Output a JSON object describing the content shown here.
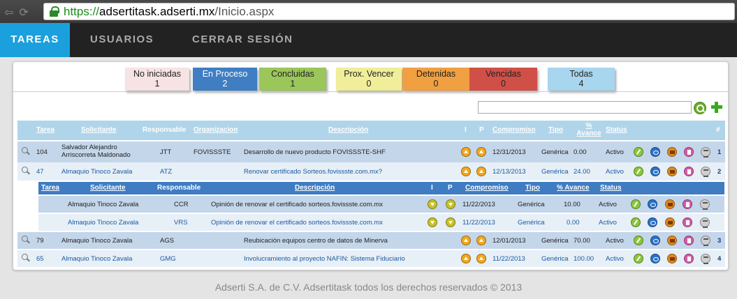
{
  "browser": {
    "url_scheme": "https://",
    "url_host": "adsertitask.adserti.mx",
    "url_path": "/Inicio.aspx"
  },
  "nav": {
    "tareas": "TAREAS",
    "usuarios": "USUARIOS",
    "cerrar": "CERRAR SESIÓN"
  },
  "filters": [
    {
      "label": "No iniciadas",
      "count": "1",
      "color": "#f7e3e3"
    },
    {
      "label": "En Proceso",
      "count": "2",
      "color": "#3f7ec2"
    },
    {
      "label": "Concluidas",
      "count": "1",
      "color": "#9bc65a"
    },
    {
      "label": "Prox. Vencer",
      "count": "0",
      "color": "#f0ee98"
    },
    {
      "label": "Detenidas",
      "count": "0",
      "color": "#f0a040"
    },
    {
      "label": "Vencidas",
      "count": "0",
      "color": "#d05048"
    },
    {
      "label": "Todas",
      "count": "4",
      "color": "#a8d6ee"
    }
  ],
  "table": {
    "headers": {
      "tarea": "Tarea",
      "solicitante": "Solicitante",
      "responsable": "Responsable",
      "organizacion": "Organizacion",
      "descripcion": "Descripción",
      "i": "I",
      "p": "P",
      "compromiso": "Compromiso",
      "tipo": "Tipo",
      "avance_1": "%",
      "avance_2": "Avance",
      "status": "Status",
      "num": "#"
    },
    "rows": [
      {
        "tarea": "104",
        "solicitante_1": "Salvador Alejandro",
        "solicitante_2": "Arriscorreta Maldonado",
        "responsable": "JTT",
        "organizacion": "FOVISSSTE",
        "descripcion": "Desarrollo de nuevo producto FOVISSSTE-SHF",
        "compromiso": "12/31/2013",
        "tipo": "Genérica",
        "avance": "0.00",
        "status": "Activo",
        "num": "1"
      },
      {
        "tarea": "47",
        "solicitante": "Almaquio Tinoco Zavala",
        "responsable": "ATZ",
        "descripcion": "Renovar certificado Sorteos.fovissste.com.mx?",
        "compromiso": "12/13/2013",
        "tipo": "Genérica",
        "avance": "24.00",
        "status": "Activo",
        "num": "2"
      },
      {
        "tarea": "79",
        "solicitante": "Almaquio Tinoco Zavala",
        "responsable": "AGS",
        "descripcion": "Reubicación equipos centro de datos de Minerva",
        "compromiso": "12/01/2013",
        "tipo": "Genérica",
        "avance": "70.00",
        "status": "Activo",
        "num": "3"
      },
      {
        "tarea": "65",
        "solicitante": "Almaquio Tinoco Zavala",
        "responsable": "GMG",
        "descripcion": "Involucramiento al proyecto NAFIN: Sistema Fiduciario",
        "compromiso": "11/22/2013",
        "tipo": "Genérica",
        "avance": "100.00",
        "status": "Activo",
        "num": "4"
      }
    ]
  },
  "subtable": {
    "headers": {
      "tarea": "Tarea",
      "solicitante": "Solicitante",
      "responsable": "Responsable",
      "descripcion": "Descripción",
      "i": "I",
      "p": "P",
      "compromiso": "Compromiso",
      "tipo": "Tipo",
      "avance": "% Avance",
      "status": "Status"
    },
    "rows": [
      {
        "solicitante": "Almaquio Tinoco Zavala",
        "responsable": "CCR",
        "descripcion": "Opinión de renovar el certificado sorteos.fovissste.com.mx",
        "compromiso": "11/22/2013",
        "tipo": "Genérica",
        "avance": "10.00",
        "status": "Activo"
      },
      {
        "solicitante": "Almaquio Tinoco Zavala",
        "responsable": "VRS",
        "descripcion": "Opinión de renovar el certificado sorteos.fovissste.com.mx",
        "compromiso": "11/22/2013",
        "tipo": "Genérica",
        "avance": "0.00",
        "status": "Activo"
      }
    ]
  },
  "footer": "Adserti S.A. de C.V. Adsertitask todos los derechos reservados © 2013"
}
